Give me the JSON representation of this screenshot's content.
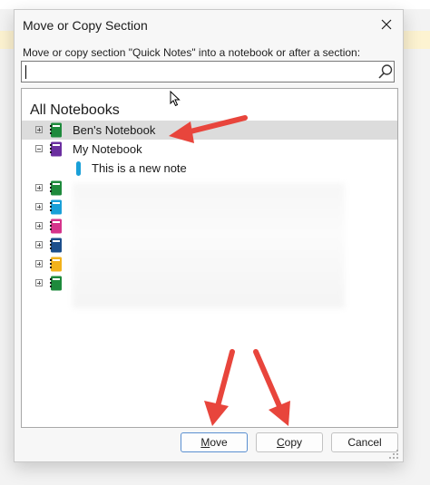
{
  "dialog": {
    "title": "Move or Copy Section",
    "close_glyph": "✕",
    "instruction": "Move or copy section \"Quick Notes\" into a notebook or after a section:",
    "search": {
      "value": "",
      "placeholder": ""
    }
  },
  "tree": {
    "heading": "All Notebooks",
    "items": [
      {
        "label": "Ben's Notebook",
        "color": "#1e8a3c",
        "expander": "plus",
        "selected": true
      },
      {
        "label": "My Notebook",
        "color": "#6b2fa0",
        "expander": "minus",
        "selected": false
      },
      {
        "label": "This is a new note",
        "section_color": "#1aa0d8"
      },
      {
        "label": "",
        "color": "#1e8a3c",
        "expander": "plus"
      },
      {
        "label": "",
        "color": "#1aa0d8",
        "expander": "plus"
      },
      {
        "label": "",
        "color": "#d6348b",
        "expander": "plus"
      },
      {
        "label": "",
        "color": "#1c4f8c",
        "expander": "plus"
      },
      {
        "label": "",
        "color": "#f2b21b",
        "expander": "plus"
      },
      {
        "label": "",
        "color": "#1e8a3c",
        "expander": "plus"
      }
    ]
  },
  "buttons": {
    "move": {
      "mnemonic": "M",
      "rest": "ove"
    },
    "copy": {
      "mnemonic": "C",
      "rest": "opy"
    },
    "cancel": "Cancel"
  },
  "annotation_color": "#e8453c",
  "icons": [
    "close-icon",
    "search-icon",
    "notebook-icon",
    "section-icon",
    "mouse-cursor-icon",
    "resize-grip-icon"
  ]
}
